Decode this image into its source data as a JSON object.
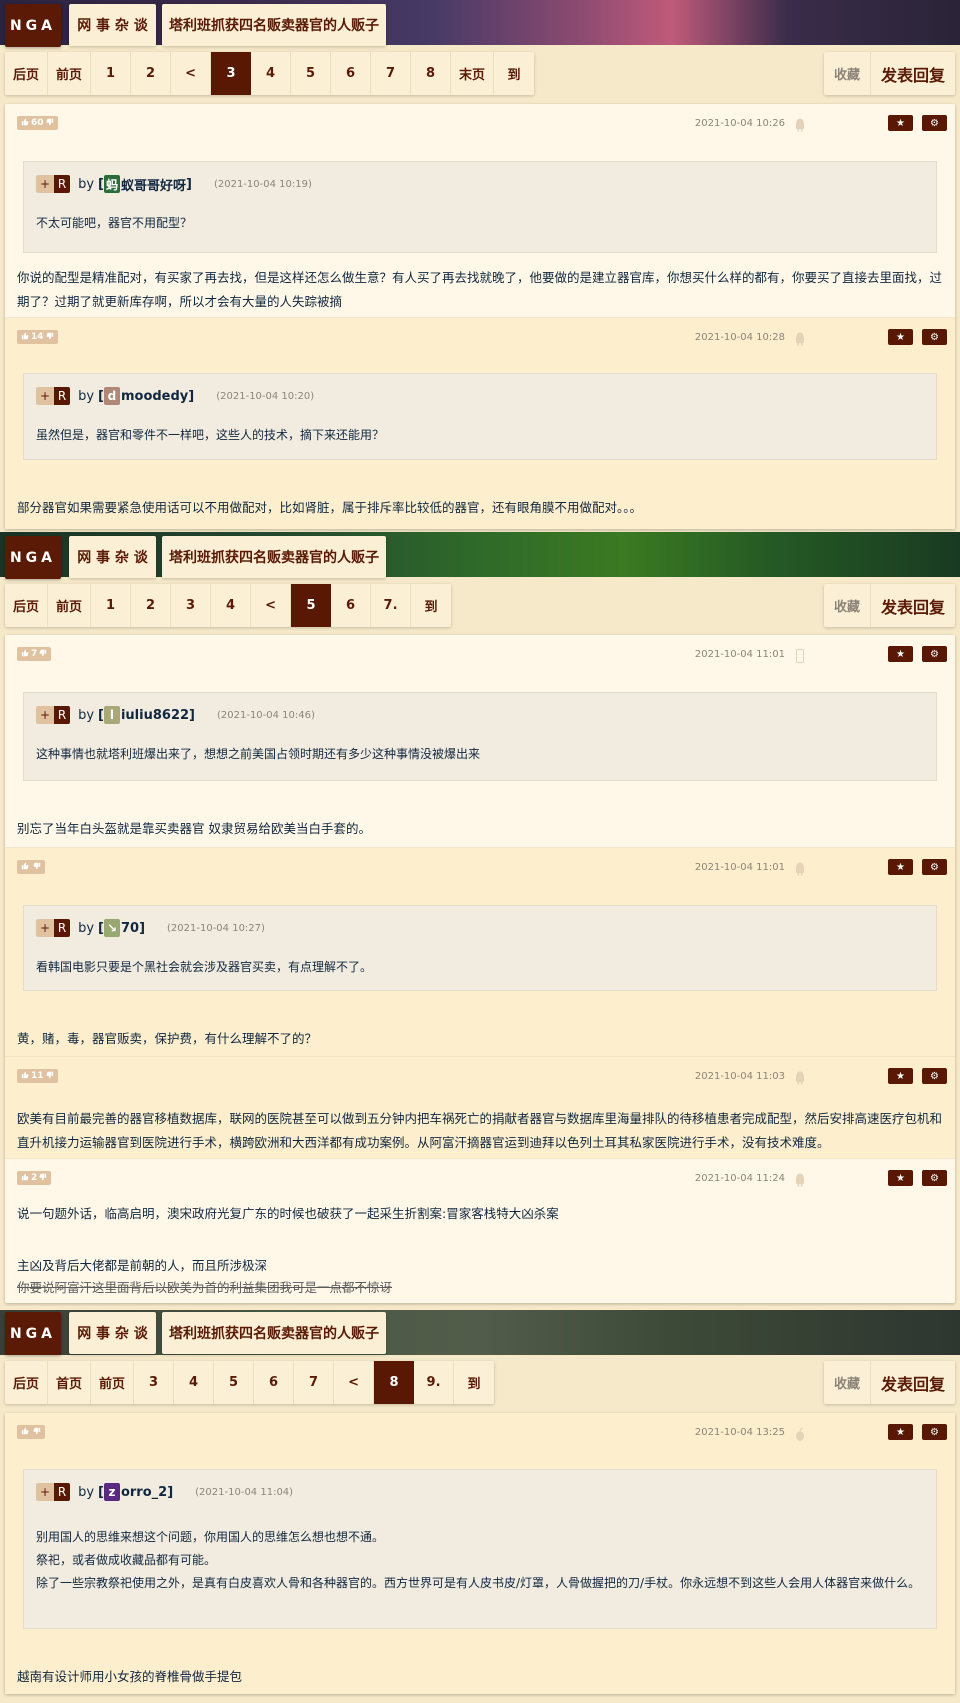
{
  "colors": {
    "accent": "#591804",
    "vote": "#e1c2a0"
  },
  "header": {
    "logo": "NGA",
    "forum": "网 事 杂 谈",
    "thread_title": "塔利班抓获四名贩卖器官的人贩子"
  },
  "actions": {
    "favorite": "收藏",
    "reply": "发表回复"
  },
  "sections": [
    {
      "pager": [
        {
          "label": "后页"
        },
        {
          "label": "前页"
        },
        {
          "label": "1"
        },
        {
          "label": "2"
        },
        {
          "label": "<"
        },
        {
          "label": "3",
          "active": true
        },
        {
          "label": "4"
        },
        {
          "label": "5"
        },
        {
          "label": "6"
        },
        {
          "label": "7"
        },
        {
          "label": "8"
        },
        {
          "label": "末页"
        },
        {
          "label": "到"
        }
      ],
      "posts": [
        {
          "votes": "60",
          "time": "2021-10-04 10:26",
          "device": "android-icon",
          "quote": {
            "plus": "+",
            "r": "R",
            "by": "by",
            "open": "[",
            "avatar": "蚂",
            "avatar_color": "#2e6b3a",
            "name": "蚁哥哥好呀",
            "close": "]",
            "time": "(2021-10-04 10:19)",
            "text": [
              "不太可能吧，器官不用配型？"
            ]
          },
          "body": [
            "你说的配型是精准配对，有买家了再去找，但是这样还怎么做生意？有人买了再去找就晚了，他要做的是建立器官库，你想买什么样的都有，你要买了直接去里面找，过期了？过期了就更新库存啊，所以才会有大量的人失踪被摘"
          ]
        },
        {
          "votes": "14",
          "time": "2021-10-04 10:28",
          "device": "android-icon",
          "quote": {
            "plus": "+",
            "r": "R",
            "by": "by",
            "open": "[",
            "avatar": "d",
            "avatar_color": "#b08878",
            "name": "moodedy",
            "close": "]",
            "time": "(2021-10-04 10:20)",
            "text": [
              "虽然但是，器官和零件不一样吧，这些人的技术，摘下来还能用？"
            ]
          },
          "body": [
            "部分器官如果需要紧急使用话可以不用做配对，比如肾脏，属于排斥率比较低的器官，还有眼角膜不用做配对。。。"
          ]
        }
      ]
    },
    {
      "pager": [
        {
          "label": "后页"
        },
        {
          "label": "前页"
        },
        {
          "label": "1"
        },
        {
          "label": "2"
        },
        {
          "label": "3"
        },
        {
          "label": "4"
        },
        {
          "label": "<"
        },
        {
          "label": "5",
          "active": true
        },
        {
          "label": "6"
        },
        {
          "label": "7."
        },
        {
          "label": "到"
        }
      ],
      "posts": [
        {
          "votes": "7",
          "time": "2021-10-04 11:01",
          "device": "phone-icon",
          "quote": {
            "plus": "+",
            "r": "R",
            "by": "by",
            "open": "[",
            "avatar": "l",
            "avatar_color": "#a8a878",
            "name": "iuliu8622",
            "close": "]",
            "time": "(2021-10-04 10:46)",
            "text": [
              "这种事情也就塔利班爆出来了，想想之前美国占领时期还有多少这种事情没被爆出来"
            ]
          },
          "body": [
            "别忘了当年白头盔就是靠买卖器官 奴隶贸易给欧美当白手套的。"
          ]
        },
        {
          "votes": "",
          "time": "2021-10-04 11:01",
          "device": "android-icon",
          "quote": {
            "plus": "+",
            "r": "R",
            "by": "by",
            "open": "[",
            "avatar": "↘",
            "avatar_color": "#98a870",
            "name": "70",
            "close": "]",
            "time": "(2021-10-04 10:27)",
            "text": [
              "看韩国电影只要是个黑社会就会涉及器官买卖，有点理解不了。"
            ]
          },
          "body": [
            "黄，赌，毒，器官贩卖，保护费，有什么理解不了的？"
          ]
        },
        {
          "votes": "11",
          "time": "2021-10-04 11:03",
          "device": "android-icon",
          "body": [
            "欧美有目前最完善的器官移植数据库，联网的医院甚至可以做到五分钟内把车祸死亡的捐献者器官与数据库里海量排队的待移植患者完成配型，然后安排高速医疗包机和直升机接力运输器官到医院进行手术，横跨欧洲和大西洋都有成功案例。从阿富汗摘器官运到迪拜以色列土耳其私家医院进行手术，没有技术难度。"
          ]
        },
        {
          "votes": "2",
          "time": "2021-10-04 11:24",
          "device": "android-icon",
          "body": [
            "说一句题外话，临高启明，澳宋政府光复广东的时候也破获了一起采生折割案:冒家客栈特大凶杀案",
            "主凶及背后大佬都是前朝的人，而且所涉极深"
          ],
          "strike": "你要说阿富汗这里面背后以欧美为首的利益集团我可是一点都不惊讶"
        }
      ]
    },
    {
      "pager": [
        {
          "label": "后页"
        },
        {
          "label": "首页"
        },
        {
          "label": "前页"
        },
        {
          "label": "3"
        },
        {
          "label": "4"
        },
        {
          "label": "5"
        },
        {
          "label": "6"
        },
        {
          "label": "7"
        },
        {
          "label": "<"
        },
        {
          "label": "8",
          "active": true
        },
        {
          "label": "9."
        },
        {
          "label": "到"
        }
      ],
      "posts": [
        {
          "votes": "",
          "time": "2021-10-04 13:25",
          "device": "apple-icon",
          "quote": {
            "plus": "+",
            "r": "R",
            "by": "by",
            "open": "[",
            "avatar": "z",
            "avatar_color": "#5a2a82",
            "name": "orro_2",
            "close": "]",
            "time": "(2021-10-04 11:04)",
            "text": [
              "别用国人的思维来想这个问题，你用国人的思维怎么想也想不通。",
              "祭祀，或者做成收藏品都有可能。",
              "除了一些宗教祭祀使用之外，是真有白皮喜欢人骨和各种器官的。西方世界可是有人皮书皮/灯罩，人骨做握把的刀/手杖。你永远想不到这些人会用人体器官来做什么。"
            ]
          },
          "body": [
            "越南有设计师用小女孩的脊椎骨做手提包"
          ]
        }
      ]
    }
  ]
}
